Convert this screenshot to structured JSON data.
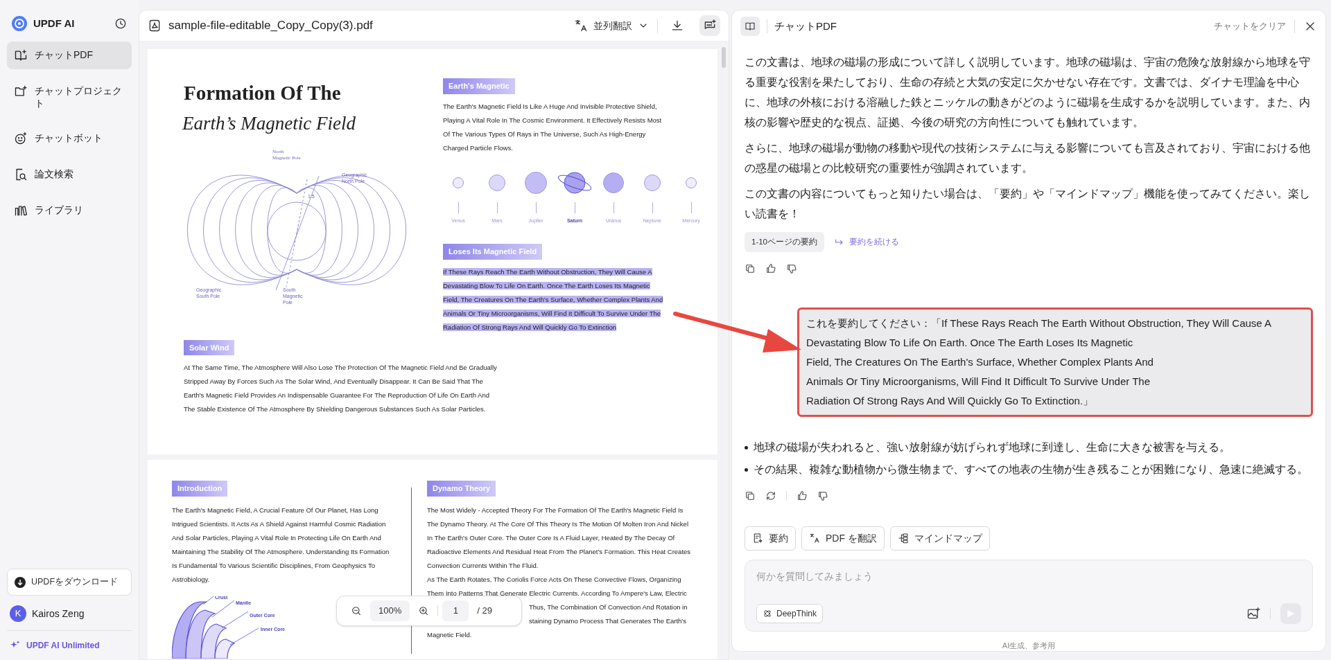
{
  "sidebar": {
    "brand": "UPDF AI",
    "nav": [
      {
        "label": "チャットPDF",
        "kind": "chat-pdf",
        "selected": true
      },
      {
        "label": "チャットプロジェクト",
        "kind": "project",
        "selected": false
      },
      {
        "label": "チャットボット",
        "kind": "bot",
        "selected": false
      },
      {
        "label": "論文検索",
        "kind": "paper-search",
        "selected": false
      },
      {
        "label": "ライブラリ",
        "kind": "library",
        "selected": false
      }
    ],
    "download_button": "UPDFをダウンロード",
    "user": {
      "initial": "K",
      "name": "Kairos Zeng"
    },
    "upgrade_link": "UPDF AI Unlimited"
  },
  "pdf_viewer": {
    "file_name": "sample-file-editable_Copy_Copy(3).pdf",
    "translate_button": "並列翻訳",
    "page_1": {
      "title": "Formation Of The",
      "subtitle": "Earth’s Magnetic Field",
      "field_labels": [
        {
          "kind": "north-magnetic",
          "lines": [
            "North",
            "Magnetic Pole"
          ]
        },
        {
          "kind": "north-geographic",
          "lines": [
            "Geographic",
            "North Pole"
          ]
        },
        {
          "kind": "angle",
          "lines": [
            "1.5"
          ]
        },
        {
          "kind": "south-geographic",
          "lines": [
            "Geographic",
            "South Pole"
          ]
        },
        {
          "kind": "south-magnetic",
          "lines": [
            "South",
            "Magnetic",
            "Pole"
          ]
        }
      ],
      "sections": [
        {
          "heading": "Earth's Magnetic",
          "paragraphs": [
            {
              "highlighted": false,
              "lines": [
                "The Earth's Magnetic Field Is Like A Huge And Invisible Protective Shield,",
                "Playing A Vital Role In The Cosmic Environment. It Effectively Resists Most",
                "Of The Various Types Of Rays in The Universe, Such As High-Energy",
                "Charged Particle Flows."
              ]
            }
          ]
        },
        {
          "heading": "Loses Its Magnetic Field",
          "paragraphs": [
            {
              "highlighted": true,
              "lines": [
                "If These Rays Reach The Earth Without Obstruction, They Will Cause A",
                "Devastating Blow To Life On Earth. Once The Earth Loses Its Magnetic",
                "Field, The Creatures On The Earth's Surface, Whether Complex Plants And",
                "Animals Or Tiny Microorganisms, Will Find It Difficult To Survive Under The",
                "Radiation Of Strong Rays And Will Quickly Go To Extinction"
              ]
            }
          ]
        },
        {
          "heading": "Solar Wind",
          "paragraphs": [
            {
              "highlighted": false,
              "lines": [
                "At The Same Time, The Atmosphere Will Also Lose The Protection Of The Magnetic Field And Be Gradually",
                "Stripped Away By Forces Such As The Solar Wind, And Eventually Disappear. It Can Be Said That The",
                "Earth's Magnetic Field Provides An Indispensable Guarantee For The Reproduction Of Life On Earth And",
                "The Stable Existence Of The Atmosphere By Shielding Dangerous Substances Such As Solar Particles."
              ]
            }
          ]
        }
      ],
      "planets": [
        {
          "name": "Venus",
          "kind": "plain"
        },
        {
          "name": "Mars",
          "kind": "plain"
        },
        {
          "name": "Jupiter",
          "kind": "plain"
        },
        {
          "name": "Saturn",
          "kind": "ringed"
        },
        {
          "name": "Uranus",
          "kind": "plain"
        },
        {
          "name": "Neptune",
          "kind": "plain"
        },
        {
          "name": "Mercury",
          "kind": "plain"
        }
      ]
    },
    "page_2": {
      "sections": [
        {
          "heading": "Introduction",
          "paragraphs": [
            {
              "lines": [
                {
                  "text": "The Earth's Magnetic Field, A Crucial Feature Of Our Planet, Has Long",
                  "covered": false
                },
                {
                  "text": "Intrigued Scientists. It Acts As A Shield Against Harmful Cosmic Radiation",
                  "covered": false
                },
                {
                  "text": "And Solar Particles, Playing A Vital Role In Protecting Life On Earth And",
                  "covered": false
                },
                {
                  "text": "Maintaining The Stability Of The Atmosphere. Understanding Its Formation",
                  "covered": false
                },
                {
                  "text": "Is Fundamental To Various Scientific Disciplines, From Geophysics To",
                  "covered": false
                },
                {
                  "text": "Astrobiology.",
                  "covered": false
                }
              ]
            }
          ]
        },
        {
          "heading": "Dynamo Theory",
          "paragraphs": [
            {
              "lines": [
                {
                  "text": "The Most Widely - Accepted Theory For The Formation Of The Earth's Magnetic Field Is",
                  "covered": false
                },
                {
                  "text": "The Dynamo Theory. At The Core Of This Theory Is The Motion Of Molten Iron And Nickel",
                  "covered": false
                },
                {
                  "text": "In The Earth's Outer Core. The Outer Core Is A Fluid Layer, Heated By The Decay Of",
                  "covered": false
                },
                {
                  "text": "Radioactive Elements And Residual Heat From The Planet's Formation. This Heat Creates",
                  "covered": false
                },
                {
                  "text": "Convection Currents Within The Fluid.",
                  "covered": false
                }
              ]
            },
            {
              "lines": [
                {
                  "text": "As The Earth Rotates, The Coriolis Force Acts On These Convective Flows, Organizing",
                  "covered": false
                },
                {
                  "text": "Them Into Patterns That Generate Electric Currents. According To Ampere's Law, Electric",
                  "covered": false
                },
                {
                  "text": "Thus, The Combination Of Convection And Rotation in",
                  "covered": true
                },
                {
                  "text": "staining Dynamo Process That Generates The Earth's",
                  "covered": true
                },
                {
                  "text": "Magnetic Field.",
                  "covered": false
                }
              ]
            }
          ]
        }
      ],
      "layer_labels": [
        "Crust",
        "Mantle",
        "Outer Core",
        "Inner Core"
      ]
    },
    "zoom_bar": {
      "zoom": "100%",
      "page": "1",
      "page_total": "/ 29"
    }
  },
  "chat": {
    "title": "チャットPDF",
    "clear_button": "チャットをクリア",
    "messages": [
      {
        "kind": "ai",
        "paragraphs": [
          "この文書は、地球の磁場の形成について詳しく説明しています。地球の磁場は、宇宙の危険な放射線から地球を守る重要な役割を果たしており、生命の存続と大気の安定に欠かせない存在です。文書では、ダイナモ理論を中心に、地球の外核における溶融した鉄とニッケルの動きがどのように磁場を生成するかを説明しています。また、内核の影響や歴史的な視点、証拠、今後の研究の方向性についても触れています。",
          "さらに、地球の磁場が動物の移動や現代の技術システムに与える影響についても言及されており、宇宙における他の惑星の磁場との比較研究の重要性が強調されています。",
          "この文書の内容についてもっと知りたい場合は、「要約」や「マインドマップ」機能を使ってみてください。楽しい読書を！"
        ],
        "chip": "1-10ページの要約",
        "continue_link": "要約を続ける",
        "regenerate": false
      },
      {
        "kind": "user",
        "outlined": true,
        "lines": [
          "これを要約してください：「If These Rays Reach The Earth Without Obstruction, They Will Cause A",
          "Devastating Blow To Life On Earth. Once The Earth Loses Its Magnetic",
          "Field, The Creatures On The Earth's Surface, Whether Complex Plants And",
          "Animals Or Tiny Microorganisms, Will Find It Difficult To Survive Under The",
          "Radiation Of Strong Rays And Will Quickly Go To Extinction.」"
        ]
      },
      {
        "kind": "ai-bullets",
        "bullets": [
          "地球の磁場が失われると、強い放射線が妨げられず地球に到達し、生命に大きな被害を与える。",
          "その結果、複雑な動植物から微生物まで、すべての地表の生物が生き残ることが困難になり、急速に絶滅する。"
        ],
        "regenerate": true
      }
    ],
    "quick_actions": [
      {
        "label": "要約",
        "kind": "summary"
      },
      {
        "label": "PDF を翻訳",
        "kind": "translate"
      },
      {
        "label": "マインドマップ",
        "kind": "mindmap"
      }
    ],
    "input": {
      "placeholder": "何かを質問してみましょう"
    },
    "deepthink_button": "DeepThink",
    "footer": "AI生成、参考用"
  }
}
